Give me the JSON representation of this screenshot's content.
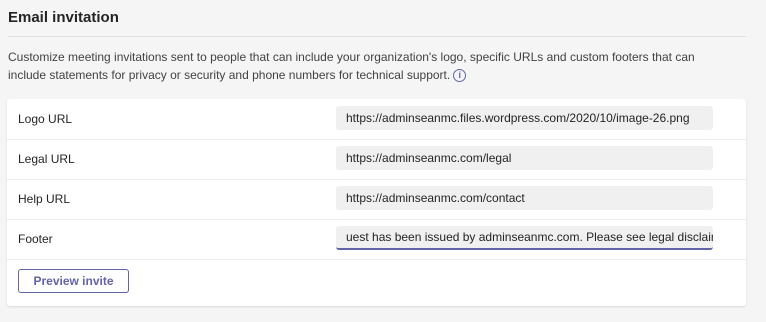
{
  "section": {
    "title": "Email invitation",
    "description": "Customize meeting invitations sent to people that can include your organization's logo, specific URLs and custom footers that can include statements for privacy or security and phone numbers for technical support.",
    "info_icon": "info-circle-icon",
    "info_glyph": "i"
  },
  "fields": [
    {
      "label": "Logo URL",
      "value": "https://adminseanmc.files.wordpress.com/2020/10/image-26.png"
    },
    {
      "label": "Legal URL",
      "value": "https://adminseanmc.com/legal"
    },
    {
      "label": "Help URL",
      "value": "https://adminseanmc.com/contact"
    },
    {
      "label": "Footer",
      "value": "uest has been issued by adminseanmc.com. Please see legal disclaimer."
    }
  ],
  "actions": {
    "preview_label": "Preview invite"
  },
  "colors": {
    "accent": "#6264a7",
    "page_background": "#f5f5f5",
    "card_background": "#ffffff",
    "input_background": "#f0f0f0"
  }
}
